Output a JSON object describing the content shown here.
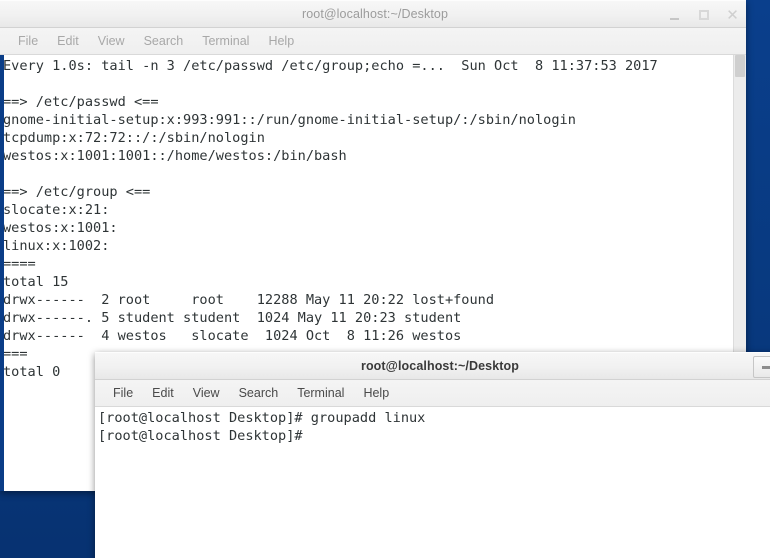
{
  "desktop": {
    "background_color": "#0a3d87"
  },
  "windows": {
    "main": {
      "title": "root@localhost:~/Desktop",
      "state": "inactive",
      "menu": [
        {
          "label": "File"
        },
        {
          "label": "Edit"
        },
        {
          "label": "View"
        },
        {
          "label": "Search"
        },
        {
          "label": "Terminal"
        },
        {
          "label": "Help"
        }
      ],
      "controls": {
        "minimize": "minimize",
        "maximize": "maximize",
        "close": "close"
      },
      "terminal_lines": [
        "Every 1.0s: tail -n 3 /etc/passwd /etc/group;echo =...  Sun Oct  8 11:37:53 2017",
        "",
        "==> /etc/passwd <==",
        "gnome-initial-setup:x:993:991::/run/gnome-initial-setup/:/sbin/nologin",
        "tcpdump:x:72:72::/:/sbin/nologin",
        "westos:x:1001:1001::/home/westos:/bin/bash",
        "",
        "==> /etc/group <==",
        "slocate:x:21:",
        "westos:x:1001:",
        "linux:x:1002:",
        "====",
        "total 15",
        "drwx------  2 root     root    12288 May 11 20:22 lost+found",
        "drwx------. 5 student student  1024 May 11 20:23 student",
        "drwx------  4 westos   slocate  1024 Oct  8 11:26 westos",
        "===",
        "total 0"
      ]
    },
    "secondary": {
      "title": "root@localhost:~/Desktop",
      "state": "active",
      "menu": [
        {
          "label": "File"
        },
        {
          "label": "Edit"
        },
        {
          "label": "View"
        },
        {
          "label": "Search"
        },
        {
          "label": "Terminal"
        },
        {
          "label": "Help"
        }
      ],
      "controls": {
        "minimize": "minimize"
      },
      "terminal_lines": [
        "[root@localhost Desktop]# groupadd linux",
        "[root@localhost Desktop]#"
      ]
    }
  }
}
